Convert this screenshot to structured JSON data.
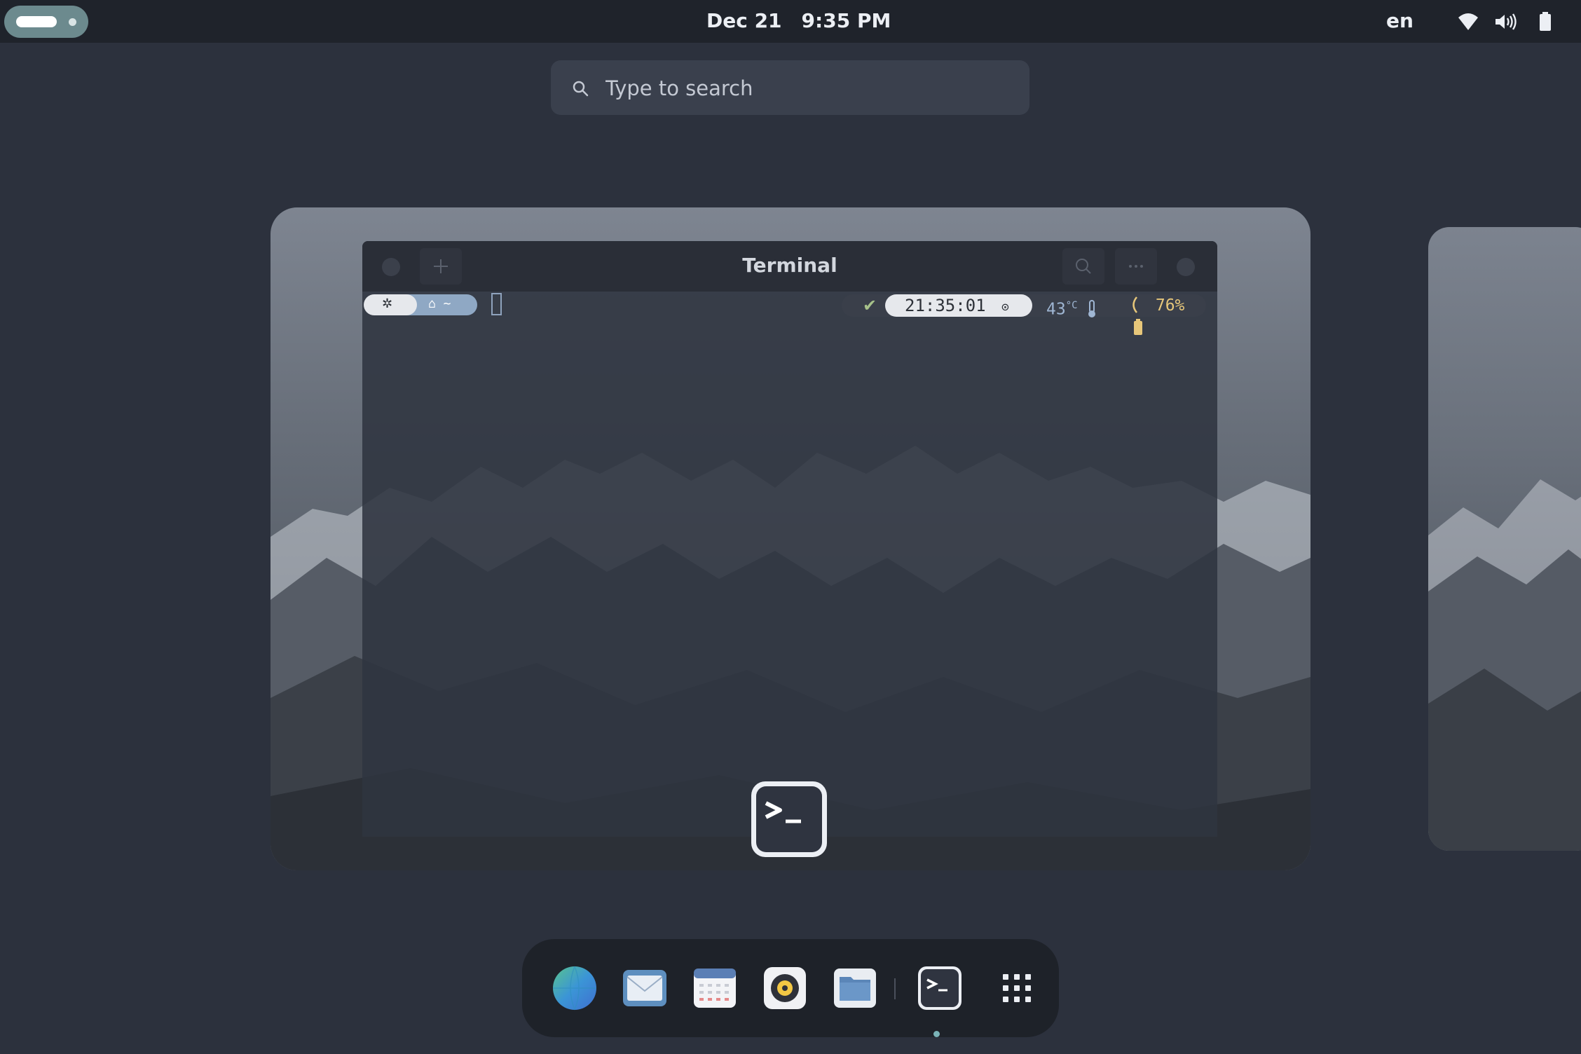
{
  "topbar": {
    "date": "Dec 21",
    "time": "9:35 PM",
    "language": "en",
    "tray_icons": [
      "wifi-icon",
      "volume-icon",
      "battery-icon"
    ]
  },
  "search": {
    "placeholder": "Type to search",
    "value": ""
  },
  "window": {
    "title": "Terminal",
    "app_icon": "terminal-icon"
  },
  "prompt": {
    "gear_glyph": "✲",
    "dir_glyphs": "⌂ ~",
    "check": "✔",
    "time": "21:35:01",
    "time_icon": "⊙",
    "temperature": "43",
    "temperature_unit": "°C",
    "battery": "76%"
  },
  "dock": {
    "items": [
      "browser-icon",
      "mail-icon",
      "calendar-icon",
      "music-icon",
      "files-icon",
      "terminal-icon",
      "app-grid-icon"
    ],
    "running": "terminal-icon"
  },
  "colors": {
    "background": "#2c313d",
    "topbar": "#1f232b",
    "accent": "#6c8a8e",
    "prompt_dir": "#8fa8c4",
    "battery_text": "#e7c77a",
    "check": "#a7c28a"
  }
}
